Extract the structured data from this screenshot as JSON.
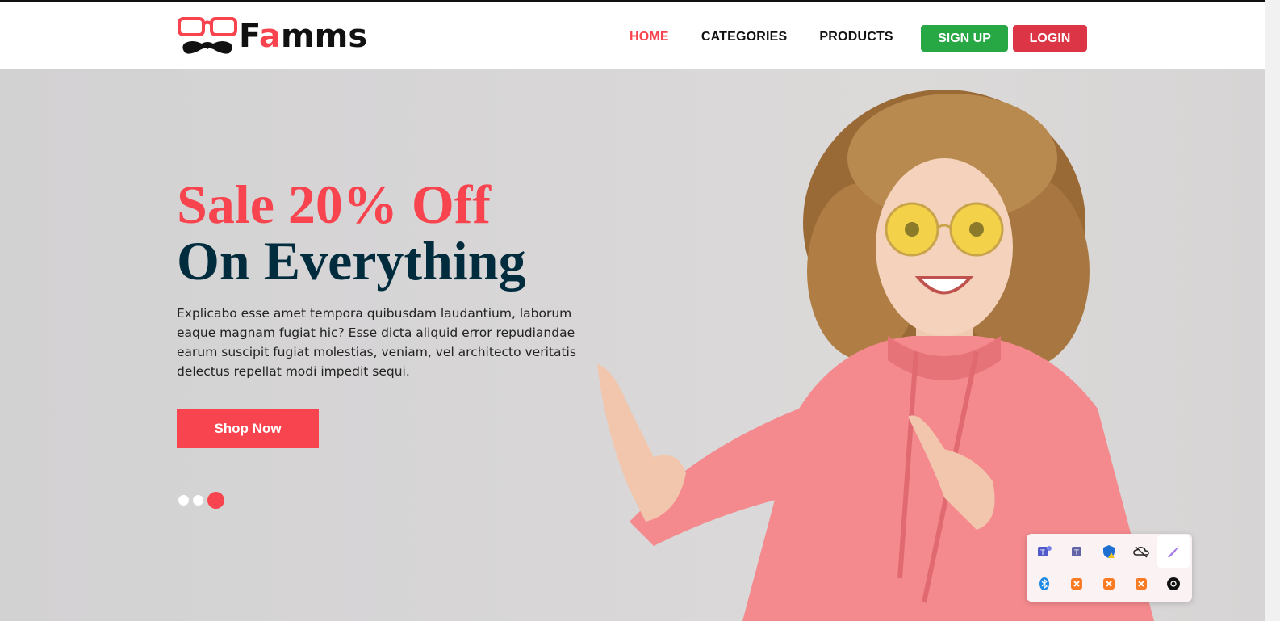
{
  "brand": {
    "name_before_accent": "F",
    "name_accent": "a",
    "name_after_accent": "mms",
    "accent_color": "#f7444e"
  },
  "nav": {
    "items": [
      {
        "label": "HOME",
        "active": true
      },
      {
        "label": "CATEGORIES",
        "active": false
      },
      {
        "label": "PRODUCTS",
        "active": false
      }
    ],
    "signup_label": "SIGN UP",
    "login_label": "LOGIN"
  },
  "hero": {
    "title_line1": "Sale 20% Off",
    "title_line2": "On Everything",
    "description": "Explicabo esse amet tempora quibusdam laudantium, laborum eaque magnam fugiat hic? Esse dicta aliquid error repudiandae earum suscipit fugiat molestias, veniam, vel architecto veritatis delectus repellat modi impedit sequi.",
    "cta_label": "Shop Now",
    "slides": 3,
    "active_slide": 3
  },
  "colors": {
    "primary": "#f7444e",
    "dark": "#002c3e",
    "signup": "#28a745",
    "login": "#dc3545"
  },
  "tray_icons": [
    "teams-icon",
    "teams-classic-icon",
    "windows-security-icon",
    "onedrive-offline-icon",
    "pen-icon",
    "bluetooth-icon",
    "xampp-icon",
    "xampp-icon",
    "xampp-icon",
    "app-icon"
  ]
}
